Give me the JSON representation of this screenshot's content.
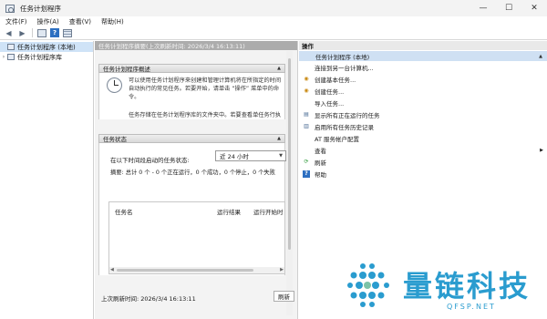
{
  "window": {
    "title": "任务计划程序",
    "minimize": "—",
    "maximize": "☐",
    "close": "✕"
  },
  "menu": [
    "文件(F)",
    "操作(A)",
    "查看(V)",
    "帮助(H)"
  ],
  "tree": {
    "root": "任务计划程序 (本地)",
    "child": "任务计划程序库"
  },
  "center": {
    "header": "任务计划程序摘要(上次刷新时间: 2026/3/4 16:13:11)",
    "overview_title": "任务计划程序概述",
    "overview_text": "可以使用任务计划程序来创建和管理计算机将在所指定的时间自动执行的常见任务。若要开始，请单击 “操作” 菜单中的命令。",
    "overview_text2": "任务存储在任务计划程序库的文件夹中。若要查看单任务行执行操作，请在任务计划程序库中选择任务。",
    "status_title": "任务状态",
    "status_label": "在以下时间段启动的任务状态:",
    "status_select": "近 24 小时",
    "summary": "摘要: 总计 0 个 - 0 个正在运行，0 个成功，0 个停止，0 个失败",
    "columns": [
      "任务名",
      "运行结果",
      "运行开始时"
    ],
    "footer_time": "上次刷新时间: 2026/3/4 16:13:11",
    "refresh": "刷新"
  },
  "actions": {
    "title": "操作",
    "group": "任务计划程序 (本地)",
    "items": [
      {
        "label": "连接到另一台计算机...",
        "icon": "none"
      },
      {
        "label": "创建基本任务...",
        "icon": "task-icon"
      },
      {
        "label": "创建任务...",
        "icon": "task-icon"
      },
      {
        "label": "导入任务...",
        "icon": "none"
      },
      {
        "label": "显示所有正在运行的任务",
        "icon": "list-icon"
      },
      {
        "label": "启用所有任务历史记录",
        "icon": "history-icon"
      },
      {
        "label": "AT 服务帐户配置",
        "icon": "none"
      },
      {
        "label": "查看",
        "icon": "none",
        "submenu": true
      },
      {
        "label": "刷新",
        "icon": "refresh-icon"
      },
      {
        "label": "帮助",
        "icon": "help-icon"
      }
    ]
  },
  "watermark": {
    "name": "量链科技",
    "url": "QFSP.NET"
  }
}
